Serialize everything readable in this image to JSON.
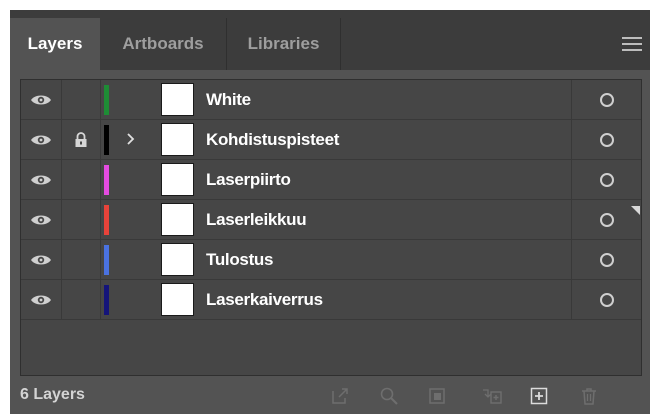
{
  "tabs": [
    {
      "label": "Layers",
      "active": true
    },
    {
      "label": "Artboards",
      "active": false
    },
    {
      "label": "Libraries",
      "active": false
    }
  ],
  "panel_menu_icon": "hamburger-menu-icon",
  "layers": [
    {
      "name": "White",
      "visible": true,
      "locked": false,
      "expandable": false,
      "color": "#1e8c35"
    },
    {
      "name": "Kohdistuspisteet",
      "visible": true,
      "locked": true,
      "expandable": true,
      "color": "#000000"
    },
    {
      "name": "Laserpiirto",
      "visible": true,
      "locked": false,
      "expandable": false,
      "color": "#e44be0"
    },
    {
      "name": "Laserleikkuu",
      "visible": true,
      "locked": false,
      "expandable": false,
      "color": "#e8433a"
    },
    {
      "name": "Tulostus",
      "visible": true,
      "locked": false,
      "expandable": false,
      "color": "#4a72e0"
    },
    {
      "name": "Laserkaiverrus",
      "visible": true,
      "locked": false,
      "expandable": false,
      "color": "#14147a"
    }
  ],
  "footer": {
    "count_label": "6 Layers",
    "icons": [
      "collect-for-export-icon",
      "locate-object-icon",
      "make-clipping-mask-icon",
      "create-sublayer-icon",
      "create-new-layer-icon",
      "delete-layer-icon"
    ]
  }
}
